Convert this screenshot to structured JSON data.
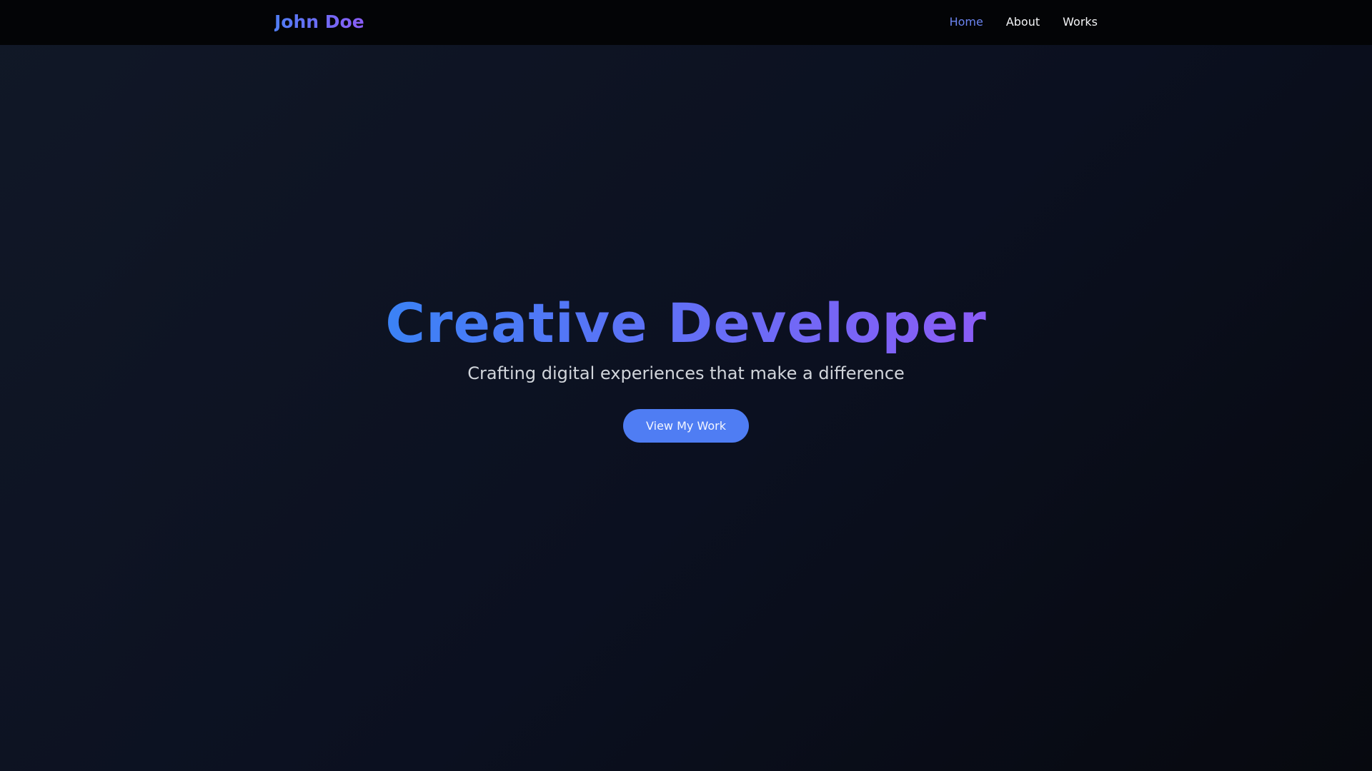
{
  "nav": {
    "brand": "John Doe",
    "links": [
      {
        "label": "Home",
        "active": true
      },
      {
        "label": "About",
        "active": false
      },
      {
        "label": "Works",
        "active": false
      }
    ]
  },
  "hero": {
    "title": "Creative Developer",
    "subtitle": "Crafting digital experiences that make a difference",
    "cta_label": "View My Work"
  },
  "colors": {
    "accent_blue": "#4f7df3",
    "accent_purple": "#8b5cf6",
    "nav_active": "#6b84f0",
    "background": "#0b1020"
  }
}
